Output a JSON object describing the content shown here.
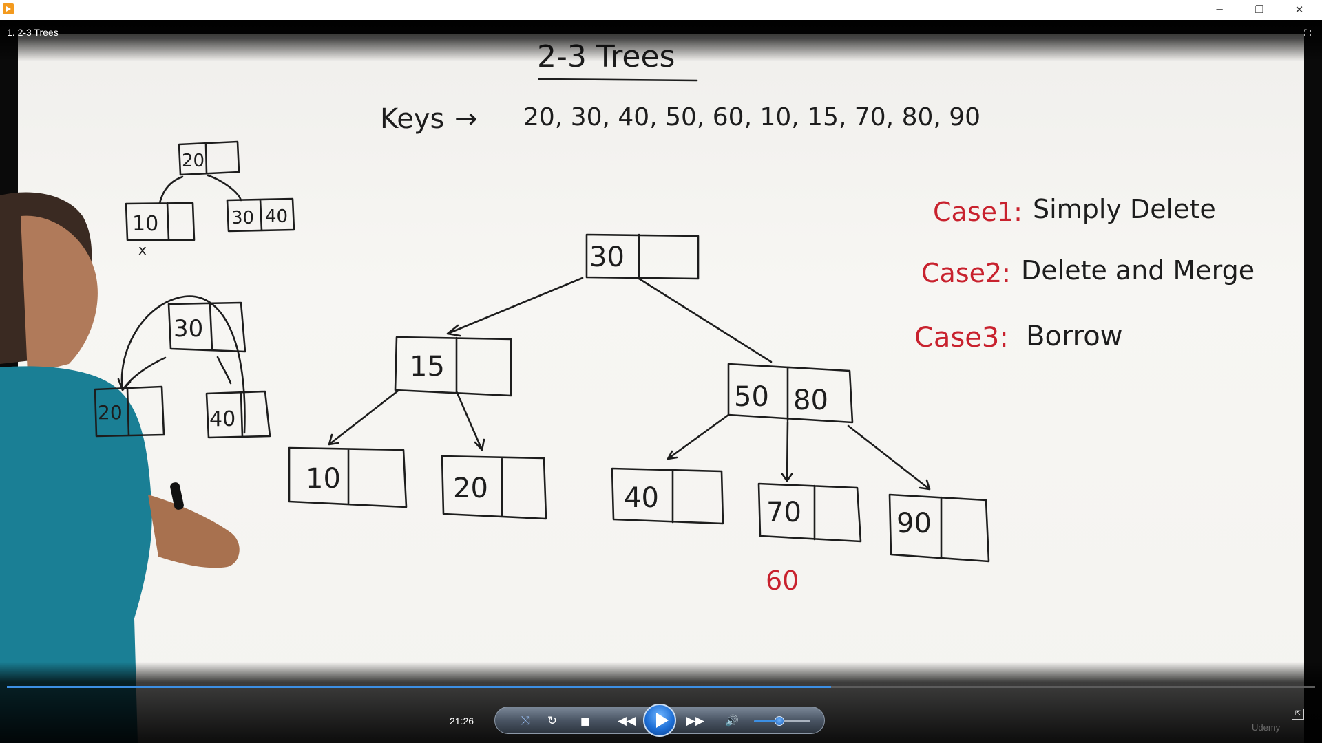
{
  "window": {
    "minimize": "─",
    "maximize": "❐",
    "close": "✕",
    "icon": "media-player-icon"
  },
  "video": {
    "title": "1. 2-3 Trees",
    "fullscreen_icon": "fullscreen-icon"
  },
  "whiteboard": {
    "heading": "2-3 Trees",
    "keys_label": "Keys",
    "keys_arrow": "→",
    "keys_values": "20, 30, 40, 50, 60, 10, 15, 70, 80, 90",
    "cases": [
      {
        "label": "Case1:",
        "text": "Simply Delete"
      },
      {
        "label": "Case2:",
        "text": "Delete and Merge"
      },
      {
        "label": "Case3:",
        "text": "Borrow"
      }
    ],
    "removed_key": "60",
    "main_tree": {
      "root": "30",
      "left": "15",
      "right_a": "50",
      "right_b": "80",
      "leaves": [
        "10",
        "20",
        "40",
        "70",
        "90"
      ]
    },
    "small_tree_1": {
      "root": "20",
      "left": "10",
      "right_a": "30",
      "right_b": "40",
      "mark": "x"
    },
    "small_tree_2": {
      "root": "30",
      "left": "20",
      "right": "40"
    }
  },
  "player": {
    "time": "21:26",
    "progress": 0.63,
    "volume": 0.45,
    "buttons": {
      "shuffle": "⤨",
      "repeat": "↻",
      "stop": "■",
      "prev": "◀◀",
      "next": "▶▶",
      "mute": "🔊",
      "switch": "⇱"
    },
    "watermark": "Udemy"
  },
  "colors": {
    "accent": "#3c8fe4",
    "ink": "#1d1d1d",
    "marker_red": "#c8222e"
  }
}
